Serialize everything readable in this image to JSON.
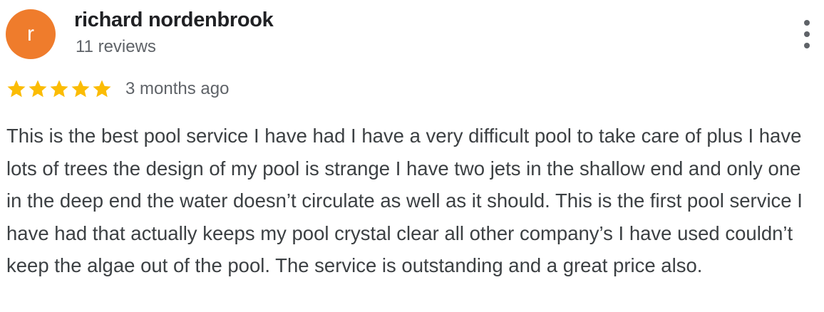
{
  "review": {
    "author": {
      "avatar_letter": "r",
      "avatar_color": "#ef7c2c",
      "name": "richard nordenbrook",
      "review_count": "11 reviews"
    },
    "rating": 5,
    "max_rating": 5,
    "star_color": "#fbbc04",
    "time": "3 months ago",
    "text": "This is the best pool service I have had I have a very difficult pool to take care of plus I have lots of trees the design of my pool is strange I have two jets in the shallow end and only one in the deep end the water doesn’t circulate as well as it should. This is the first pool service I have had that actually keeps my pool crystal clear all other company’s I have used couldn’t keep the algae out of the pool. The service is outstanding and a great price also."
  },
  "menu": {
    "icon": "more-vert-icon"
  }
}
